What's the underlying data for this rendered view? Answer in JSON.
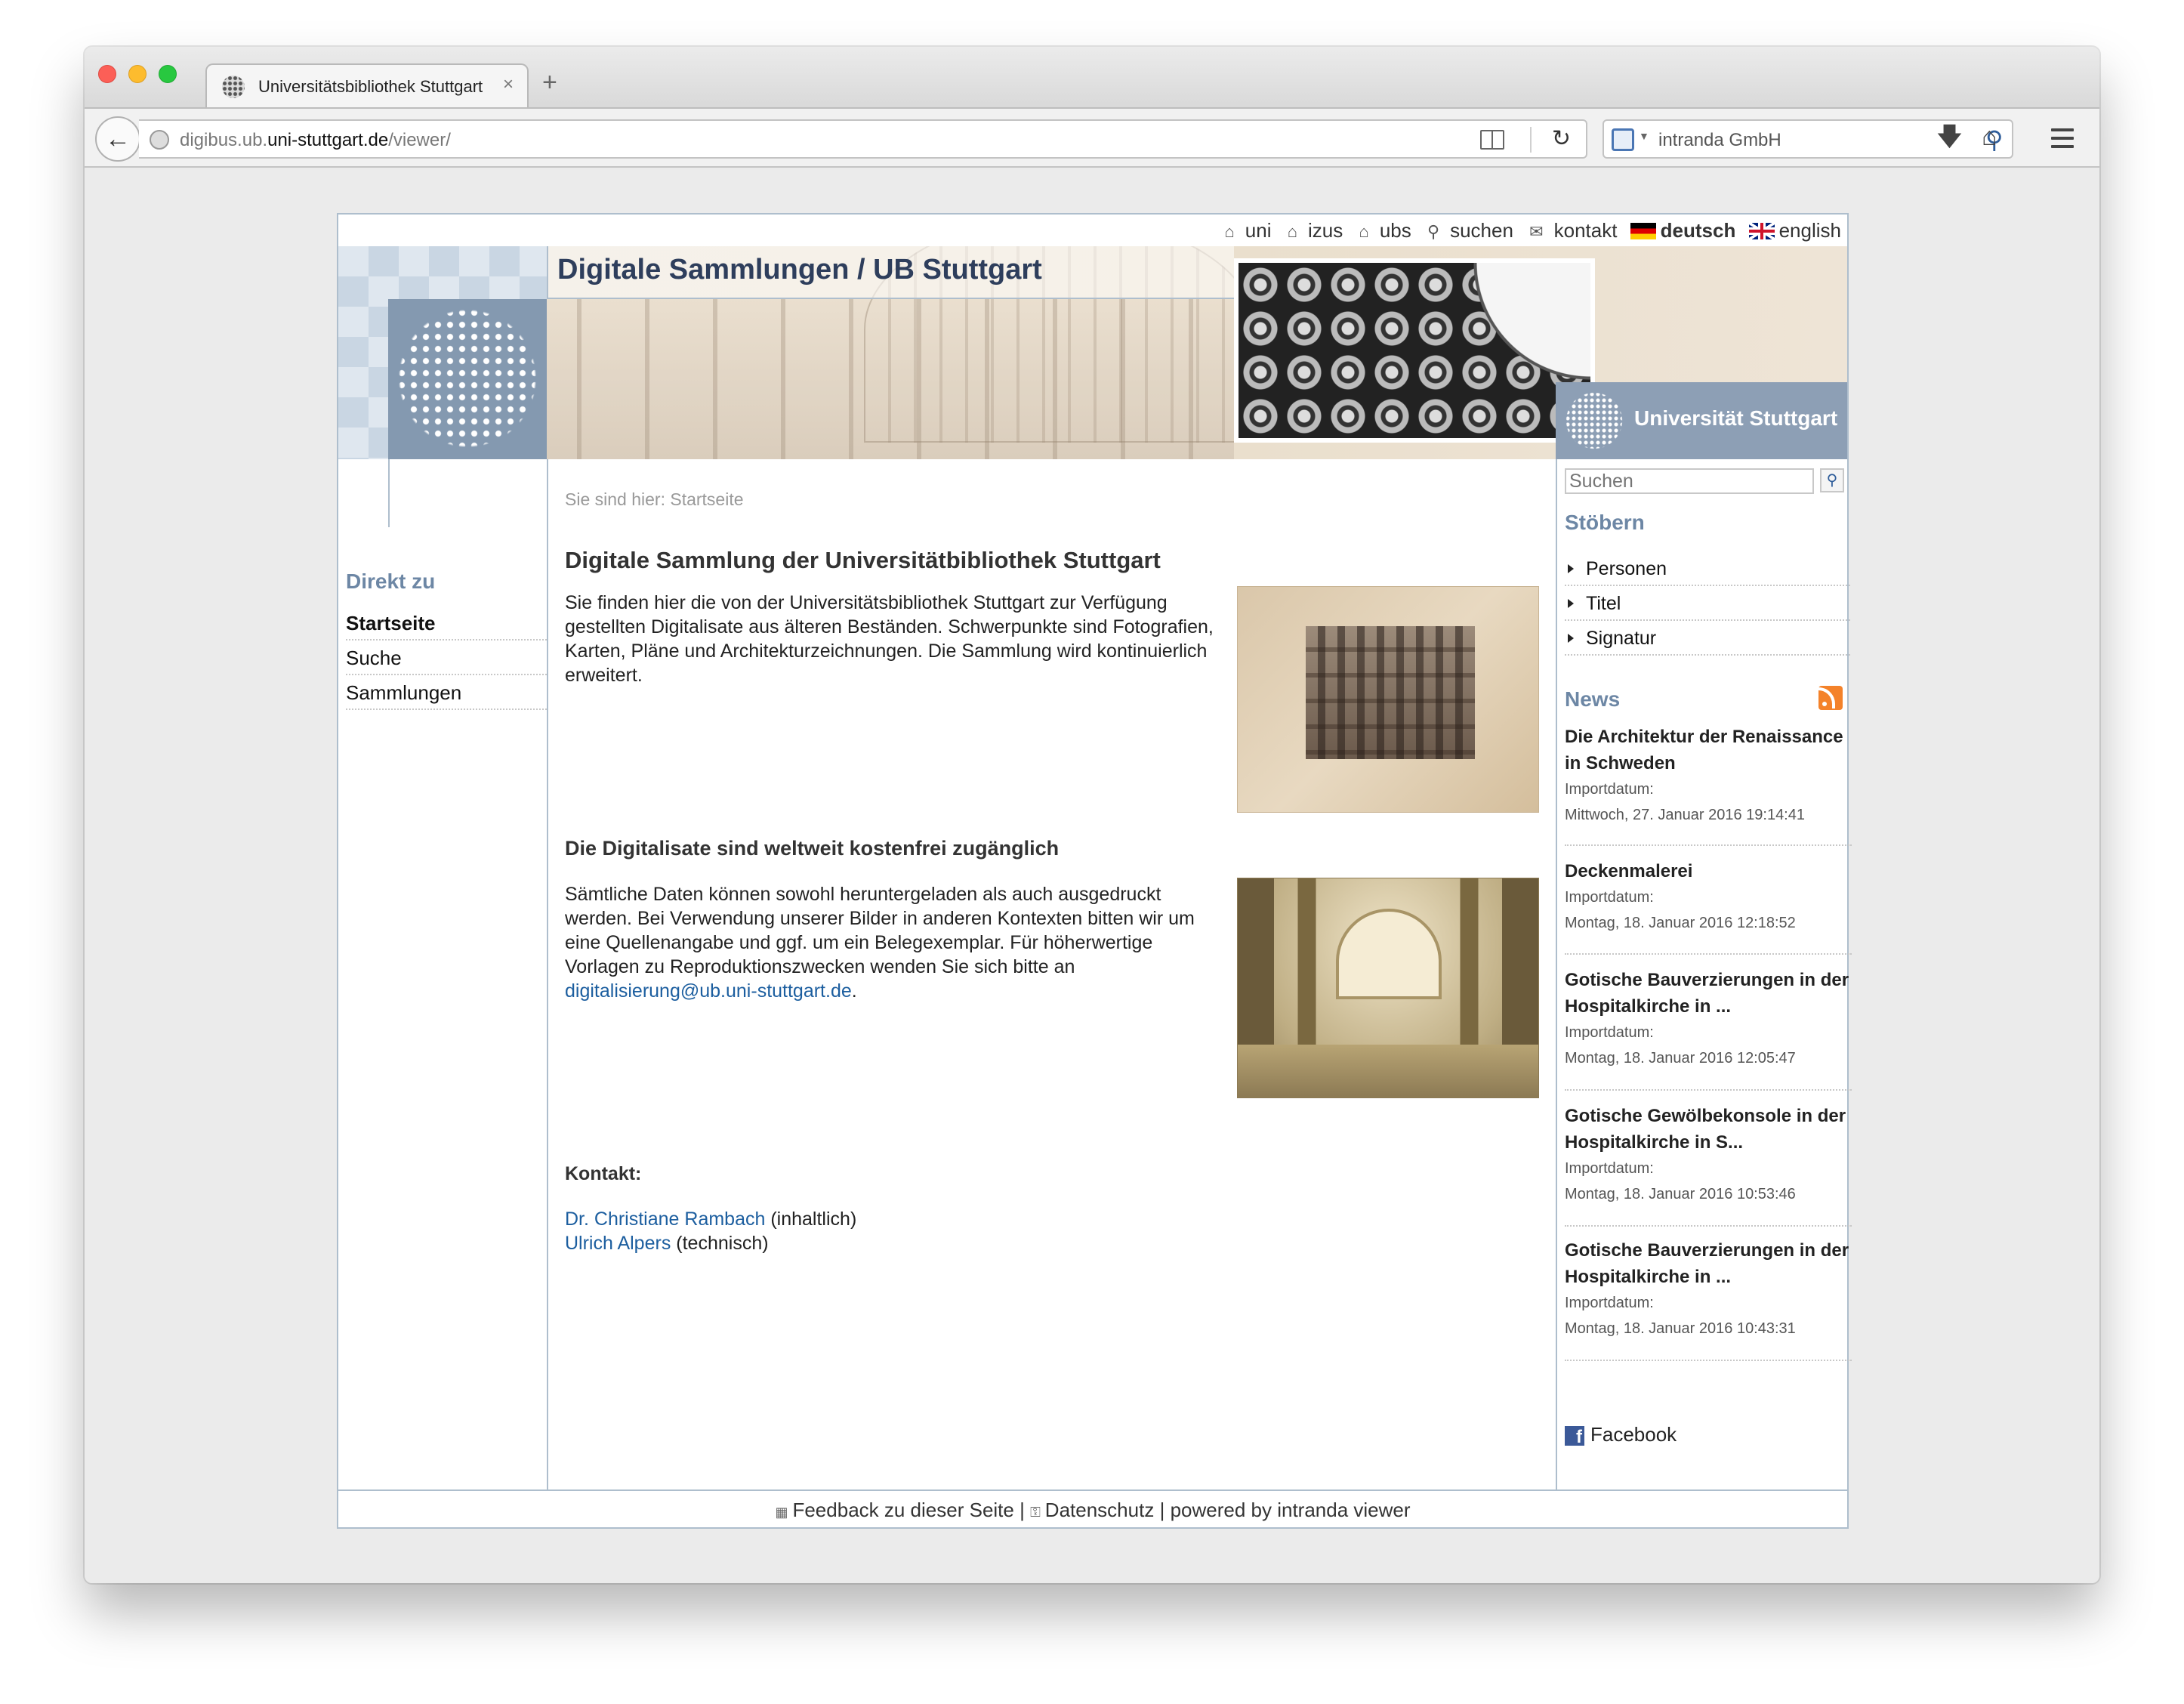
{
  "browser": {
    "tab_title": "Universitätsbibliothek Stuttgart",
    "new_tab": "+",
    "tab_close": "×",
    "url_prefix": "digibus.ub.",
    "url_domain": "uni-stuttgart.de",
    "url_path": "/viewer/",
    "search_engine_text": "intranda GmbH"
  },
  "toplinks": {
    "uni": "uni",
    "izus": "izus",
    "ubs": "ubs",
    "suchen": "suchen",
    "kontakt": "kontakt",
    "deutsch": "deutsch",
    "english": "english"
  },
  "banner": {
    "title": "Digitale Sammlungen / UB Stuttgart",
    "uni_name": "Universität Stuttgart"
  },
  "left": {
    "title": "Direkt zu",
    "items": [
      {
        "label": "Startseite"
      },
      {
        "label": "Suche"
      },
      {
        "label": "Sammlungen"
      }
    ]
  },
  "main": {
    "breadcrumb": "Sie sind hier: Startseite",
    "heading": "Digitale Sammlung der Universitätbibliothek Stuttgart",
    "intro": "Sie finden hier die von der Universitätsbibliothek Stuttgart zur Verfügung gestellten Digitalisate aus älteren Beständen. Schwerpunkte sind Fotografien, Karten, Pläne und Architekturzeichnungen. Die Sammlung wird kontinuierlich erweitert.",
    "subheading": "Die Digitalisate sind weltweit kostenfrei zugänglich",
    "body": "Sämtliche Daten können sowohl heruntergeladen als auch ausgedruckt werden. Bei Verwendung unserer Bilder in anderen Kontexten bitten wir um eine Quellenangabe und ggf. um ein Belegexemplar. Für höherwertige Vorlagen zu Reproduktionszwecken wenden Sie sich bitte an",
    "email": "digitalisierung@ub.uni-stuttgart.de",
    "email_suffix": ".",
    "contact_heading": "Kontakt:",
    "contacts": [
      {
        "name": "Dr. Christiane Rambach",
        "role": "(inhaltlich)"
      },
      {
        "name": "Ulrich Alpers",
        "role": "(technisch)"
      }
    ]
  },
  "right": {
    "search_placeholder": "Suchen",
    "browse_title": "Stöbern",
    "browse_items": [
      {
        "label": "Personen"
      },
      {
        "label": "Titel"
      },
      {
        "label": "Signatur"
      }
    ],
    "news_title": "News",
    "news": [
      {
        "title": "Die Architektur der Renaissance in Schweden",
        "label": "Importdatum:",
        "date": "Mittwoch, 27. Januar 2016 19:14:41"
      },
      {
        "title": "Deckenmalerei",
        "label": "Importdatum:",
        "date": "Montag, 18. Januar 2016 12:18:52"
      },
      {
        "title": "Gotische Bauverzierungen in der Hospitalkirche in ...",
        "label": "Importdatum:",
        "date": "Montag, 18. Januar 2016 12:05:47"
      },
      {
        "title": "Gotische Gewölbekonsole in der Hospitalkirche in S...",
        "label": "Importdatum:",
        "date": "Montag, 18. Januar 2016 10:53:46"
      },
      {
        "title": "Gotische Bauverzierungen in der Hospitalkirche in ...",
        "label": "Importdatum:",
        "date": "Montag, 18. Januar 2016 10:43:31"
      }
    ],
    "facebook": "Facebook"
  },
  "footer": {
    "feedback": "Feedback zu dieser Seite",
    "sep": "|",
    "privacy": "Datenschutz",
    "powered": "powered by",
    "viewer": "intranda viewer"
  }
}
